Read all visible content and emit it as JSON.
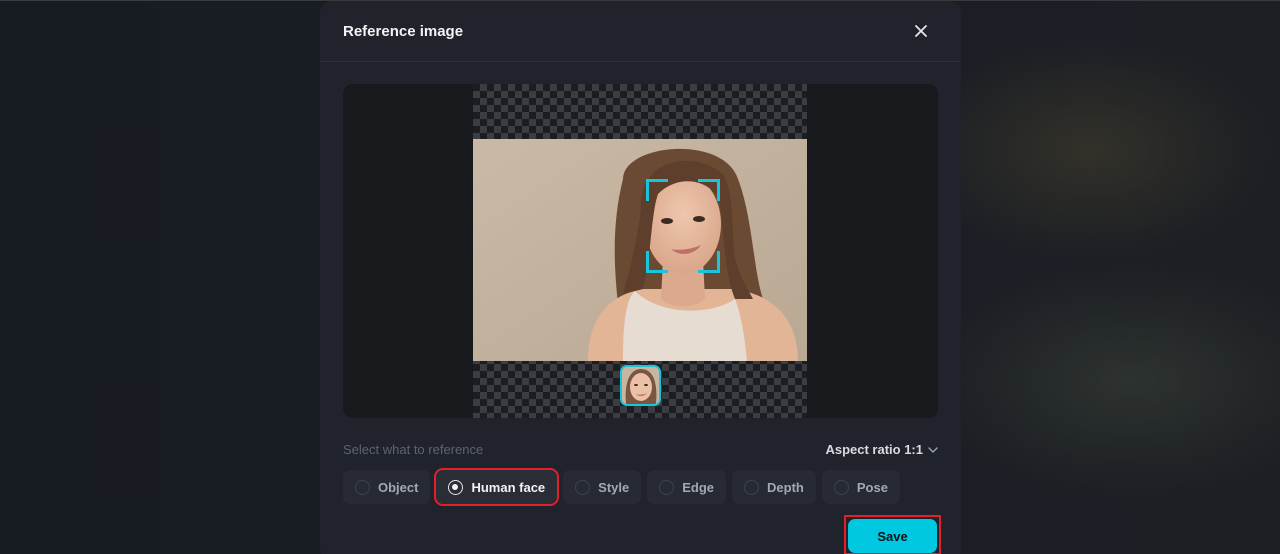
{
  "dialog": {
    "title": "Reference image",
    "close_icon": "close-icon"
  },
  "preview": {
    "image_description": "Portrait of smiling woman with long brown hair on beige background",
    "face_detection_frame": "face-selection-corners",
    "thumbnail_description": "Detected face crop thumbnail"
  },
  "reference": {
    "label": "Select what to reference",
    "aspect_ratio_label": "Aspect ratio 1:1",
    "aspect_ratio_icon": "chevron-down-icon",
    "selected": "Human face",
    "options": [
      {
        "label": "Object",
        "selected": false
      },
      {
        "label": "Human face",
        "selected": true
      },
      {
        "label": "Style",
        "selected": false
      },
      {
        "label": "Edge",
        "selected": false
      },
      {
        "label": "Depth",
        "selected": false
      },
      {
        "label": "Pose",
        "selected": false
      }
    ]
  },
  "footer": {
    "save_label": "Save"
  },
  "colors": {
    "accent": "#00c8e0",
    "face_frame": "#19c5dd",
    "highlight_outline": "#e0202a",
    "dialog_bg": "#20232b"
  }
}
